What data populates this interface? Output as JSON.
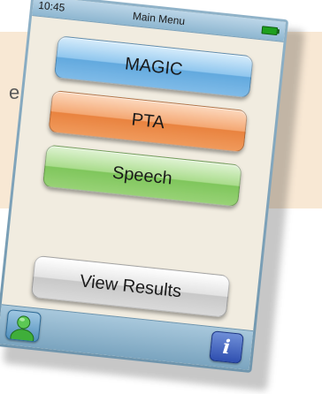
{
  "page": {
    "side_text": "e"
  },
  "status_bar": {
    "time": "10:45",
    "title": "Main Menu",
    "battery_icon": "battery-full-icon",
    "battery_color": "#1ea01e"
  },
  "menu": {
    "magic_label": "MAGIC",
    "pta_label": "PTA",
    "speech_label": "Speech",
    "results_label": "View Results"
  },
  "bottom_bar": {
    "user_icon": "user-icon",
    "info_icon": "info-icon",
    "info_glyph": "i"
  },
  "colors": {
    "magic": "#7fbbe8",
    "pta": "#f09a5c",
    "speech": "#98d276",
    "results": "#dadada",
    "panel_background": "#f8e8d4"
  }
}
